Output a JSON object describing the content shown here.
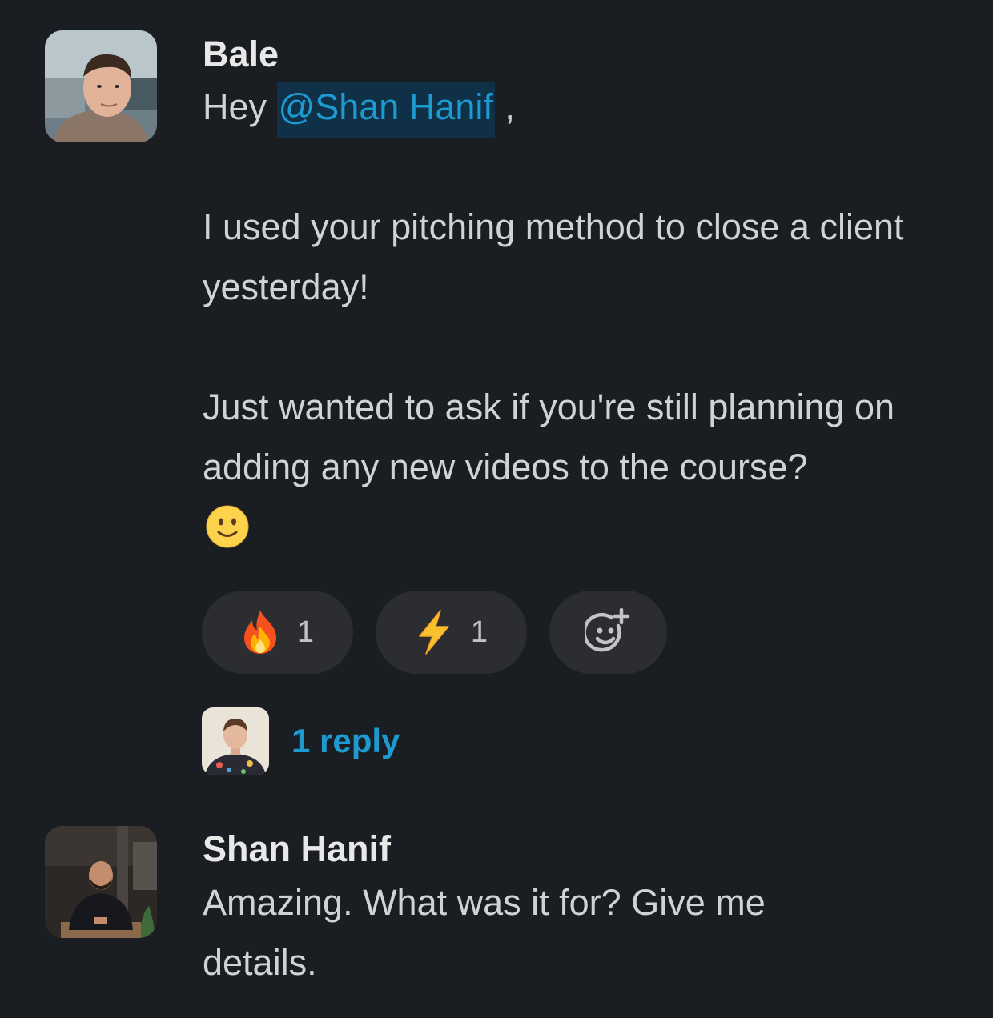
{
  "messages": [
    {
      "author": "Bale",
      "greeting": "Hey",
      "mention": "@Shan Hanif",
      "greeting_suffix": " ,",
      "paragraph1": "I used your pitching method to close a client yesterday!",
      "paragraph2": "Just wanted to ask if you're still planning on adding any new videos to the course?",
      "emoji": "slightly-smiling-face-emoji",
      "reactions": [
        {
          "emoji": "fire-emoji",
          "count": "1"
        },
        {
          "emoji": "zap-emoji",
          "count": "1"
        }
      ],
      "add_reaction_icon": "add-reaction-icon",
      "thread": {
        "reply_label": "1 reply"
      }
    },
    {
      "author": "Shan Hanif",
      "text": "Amazing. What was it for? Give me details."
    }
  ],
  "colors": {
    "background": "#1a1d21",
    "text": "#d1d2d3",
    "author": "#e8e8e8",
    "link": "#1d9bd1",
    "mention_bg": "#0f3046",
    "reaction_bg": "#2c2d30"
  }
}
